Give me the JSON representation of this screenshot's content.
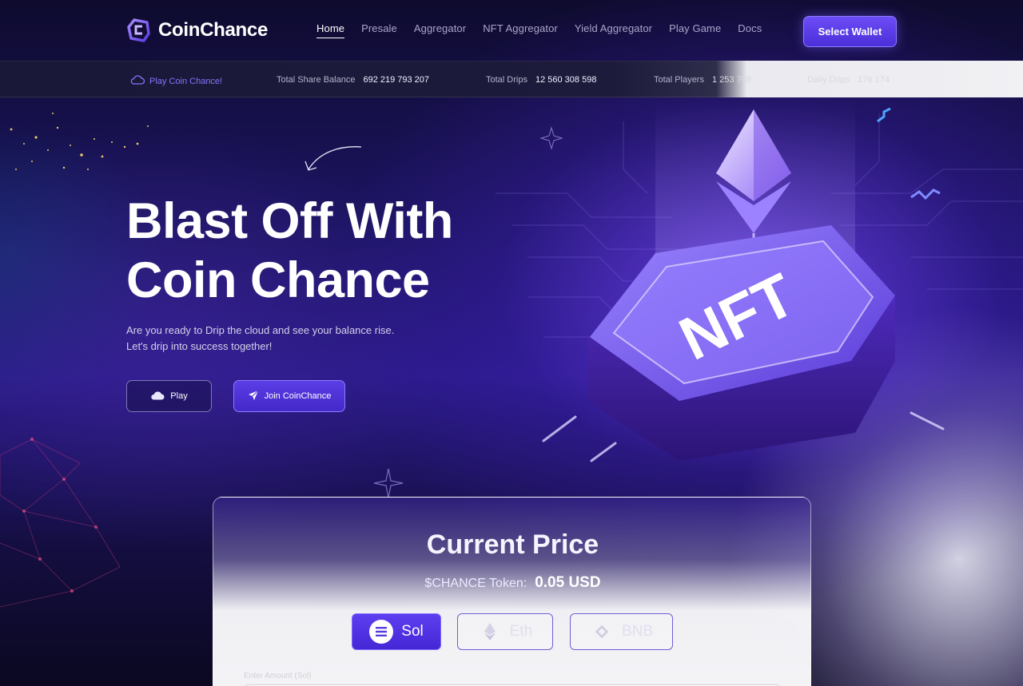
{
  "brand": {
    "name": "CoinChance"
  },
  "nav": {
    "items": [
      {
        "label": "Home",
        "active": true
      },
      {
        "label": "Presale"
      },
      {
        "label": "Aggregator"
      },
      {
        "label": "NFT Aggregator"
      },
      {
        "label": "Yield Aggregator"
      },
      {
        "label": "Play Game"
      },
      {
        "label": "Docs"
      }
    ],
    "wallet_button": "Select Wallet"
  },
  "stats": {
    "play_link": "Play Coin Chance!",
    "items": [
      {
        "label": "Total Share Balance",
        "value": "692 219 793 207"
      },
      {
        "label": "Total Drips",
        "value": "12 560 308 598"
      },
      {
        "label": "Total Players",
        "value": "1 253 768"
      },
      {
        "label": "Daily Drips",
        "value": "176 174"
      }
    ]
  },
  "hero": {
    "title_line1": "Blast Off With",
    "title_line2": "Coin Chance",
    "desc_line1": "Are you ready to Drip the cloud and see your balance rise.",
    "desc_line2": "Let's drip into success together!",
    "play_button": "Play",
    "join_button": "Join CoinChance",
    "art_label": "NFT"
  },
  "price_card": {
    "title": "Current Price",
    "token_label": "$CHANCE Token:",
    "token_price": "0.05 USD",
    "chains": [
      {
        "label": "Sol",
        "active": true
      },
      {
        "label": "Eth",
        "active": false
      },
      {
        "label": "BNB",
        "active": false
      }
    ],
    "amount_label": "Enter Amount (Sol)"
  },
  "colors": {
    "accent": "#5b3ee5",
    "accent_light": "#8a73ff",
    "background": "#0b0a24"
  }
}
